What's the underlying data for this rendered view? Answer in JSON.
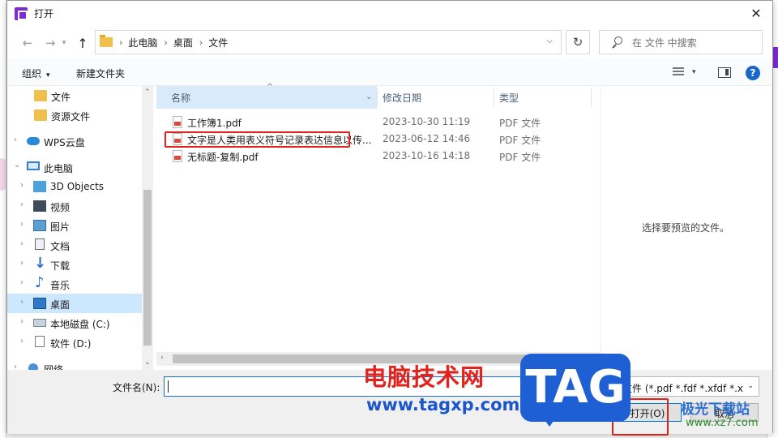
{
  "window": {
    "title": "打开",
    "close_glyph": "✕"
  },
  "nav": {
    "back_glyph": "←",
    "forward_glyph": "→",
    "up_glyph": "↑",
    "breadcrumbs": [
      "此电脑",
      "桌面",
      "文件"
    ],
    "crumb_sep": "›",
    "dropdown_glyph": "⌵",
    "refresh_glyph": "↻",
    "search_placeholder": "在 文件 中搜索"
  },
  "toolbar": {
    "organize_label": "组织",
    "new_folder_label": "新建文件夹",
    "caret": "▾",
    "help_glyph": "?"
  },
  "sidebar": {
    "items": [
      {
        "label": "文件",
        "icon": "folder-icon",
        "chevron": ""
      },
      {
        "label": "资源文件",
        "icon": "folder-icon",
        "chevron": ""
      },
      {
        "label": "WPS云盘",
        "icon": "cloud-icon",
        "chevron": "›"
      },
      {
        "label": "此电脑",
        "icon": "computer-icon",
        "chevron": "⌄"
      },
      {
        "label": "3D Objects",
        "icon": "3d-objects-icon",
        "chevron": "›"
      },
      {
        "label": "视频",
        "icon": "video-icon",
        "chevron": "›"
      },
      {
        "label": "图片",
        "icon": "pictures-icon",
        "chevron": "›"
      },
      {
        "label": "文档",
        "icon": "documents-icon",
        "chevron": "›"
      },
      {
        "label": "下载",
        "icon": "download-icon",
        "chevron": "›"
      },
      {
        "label": "音乐",
        "icon": "music-icon",
        "chevron": "›"
      },
      {
        "label": "桌面",
        "icon": "desktop-icon",
        "chevron": "›"
      },
      {
        "label": "本地磁盘 (C:)",
        "icon": "drive-icon",
        "chevron": "›"
      },
      {
        "label": "软件 (D:)",
        "icon": "drive-icon",
        "chevron": "›"
      },
      {
        "label": "网络",
        "icon": "network-icon",
        "chevron": "›"
      }
    ],
    "selected": "桌面",
    "scroll_up": "⌃",
    "scroll_down": "⌄"
  },
  "files": {
    "columns": {
      "name": "名称",
      "date": "修改日期",
      "type": "类型"
    },
    "sort_glyph": "^",
    "col_caret": "⌄",
    "rows": [
      {
        "name": "工作簿1.pdf",
        "date": "2023-10-30 11:19",
        "type": "PDF 文件"
      },
      {
        "name": "文字是人类用表义符号记录表达信息以传...",
        "date": "2023-06-12 14:46",
        "type": "PDF 文件"
      },
      {
        "name": "无标题-复制.pdf",
        "date": "2023-10-16 14:18",
        "type": "PDF 文件"
      }
    ],
    "hscroll_left": "‹",
    "hscroll_right": "›"
  },
  "preview": {
    "text": "选择要预览的文件。"
  },
  "footer": {
    "filename_label": "文件名(N):",
    "filename_value": "",
    "filetype_value": "图文件 (*.pdf *.fdf *.xfdf *.x",
    "filetype_caret": "⌄",
    "open_label": "打开(O)",
    "cancel_label": "取消"
  },
  "watermark": {
    "site_name": "电脑技术网",
    "site_url": "www.tagxp.com",
    "tag": "TAG",
    "brand": "极光下载站",
    "brand_url": "www.xz7.com"
  },
  "colors": {
    "accent": "#0078d7",
    "selection": "#cce8ff",
    "highlight": "#e0231c",
    "app_purple": "#7c2bd6"
  }
}
